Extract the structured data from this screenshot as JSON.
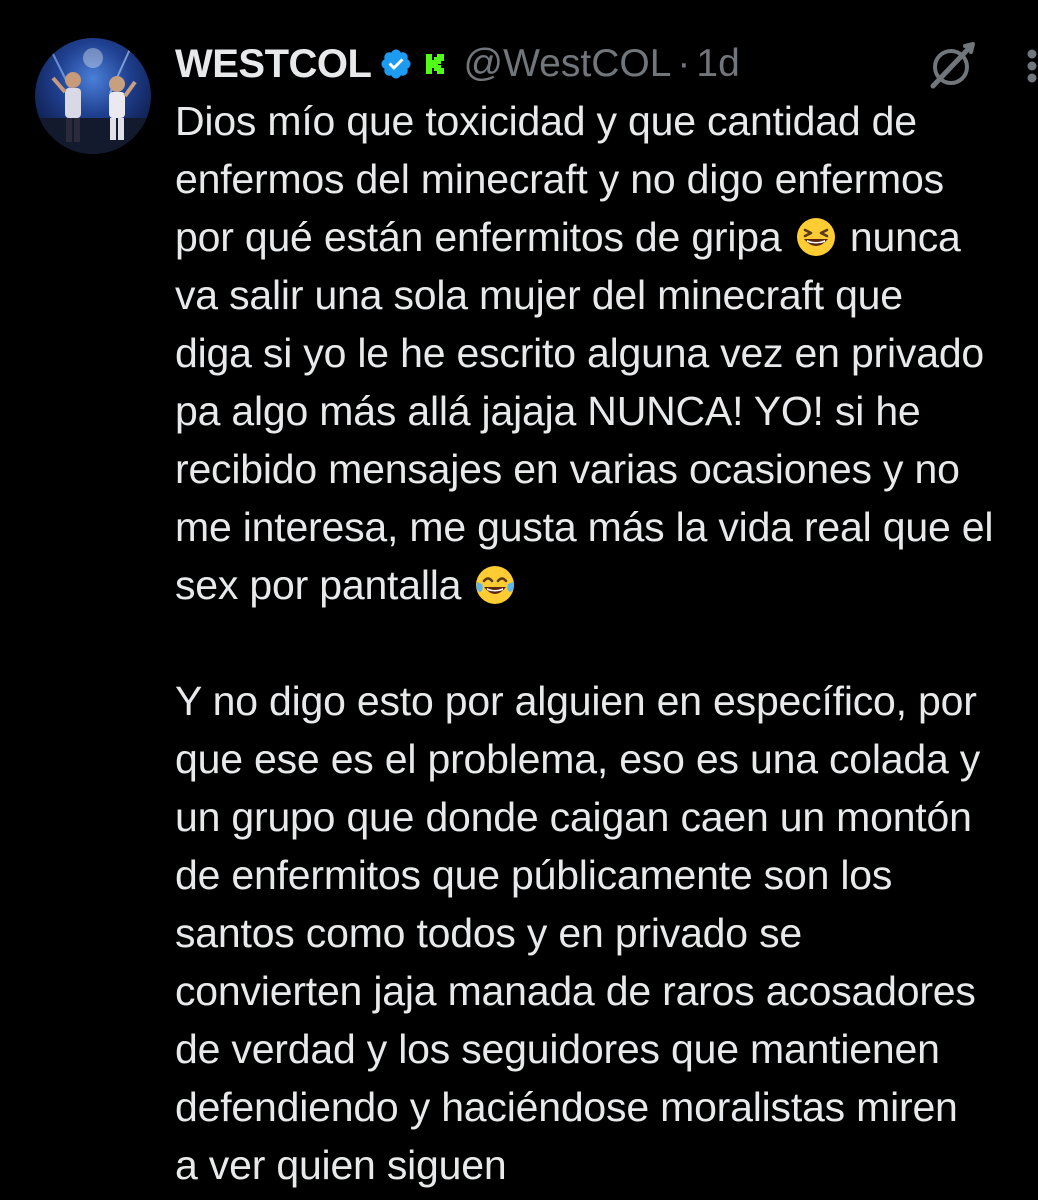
{
  "tweet": {
    "author_name": "WESTCOL",
    "handle": "@WestCOL",
    "separator": "·",
    "time": "1d",
    "colors": {
      "background": "#000000",
      "text": "#e7e9ea",
      "muted": "#71767b",
      "verified": "#1d9bf0",
      "kick": "#53fc18"
    },
    "icons": [
      "avatar",
      "verified-badge-icon",
      "kick-icon",
      "grok-icon",
      "more-options-icon",
      "grinning-squinting-face-emoji",
      "face-with-tears-of-joy-emoji"
    ],
    "lines": [
      "Dios mío que toxicidad y que cantidad de",
      "enfermos del minecraft y no digo enfermos",
      "por qué están enfermitos de gripa",
      "nunca",
      "va salir una sola mujer del minecraft que",
      "diga si yo le he escrito alguna vez en privado",
      "pa algo más allá jajaja NUNCA!  YO! si he",
      "recibido mensajes en varias ocasiones y no",
      "me interesa, me gusta más la vida real que el",
      "sex por pantalla",
      "Y no digo esto por alguien en específico, por",
      "que ese es el problema, eso es una colada y",
      "un grupo que donde caigan caen un montón",
      "de enfermitos que públicamente son los",
      "santos como todos y en privado se",
      "convierten jaja manada de raros acosadores",
      "de verdad y los seguidores que mantienen",
      "defendiendo y haciéndose moralistas miren",
      "a ver quien siguen"
    ]
  }
}
